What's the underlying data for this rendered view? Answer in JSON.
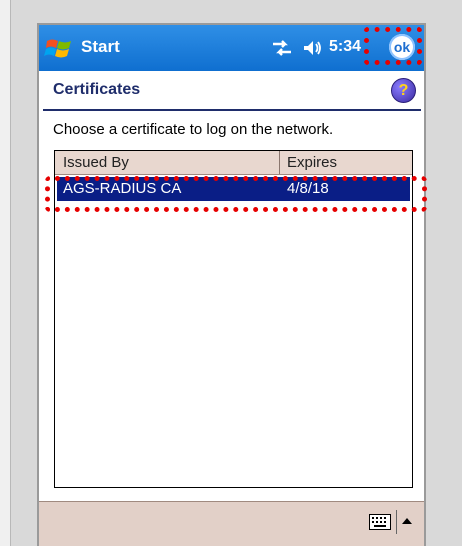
{
  "titlebar": {
    "title": "Start",
    "clock": "5:34",
    "ok_label": "ok"
  },
  "header": {
    "title": "Certificates",
    "help_symbol": "?"
  },
  "instruction": "Choose a certificate to log on the network.",
  "certificate_list": {
    "columns": [
      "Issued By",
      "Expires"
    ],
    "rows": [
      {
        "issued_by": "AGS-RADIUS CA",
        "expires": "4/8/18",
        "selected": true
      }
    ]
  },
  "icons": {
    "start_logo": "windows-flag-icon",
    "connectivity": "connectivity-icon",
    "volume": "speaker-icon",
    "help": "help-icon",
    "keyboard": "keyboard-icon",
    "input_menu": "up-arrow-icon"
  },
  "colors": {
    "titlebar": "#1f7fe0",
    "selection": "#0a1e86",
    "annotation": "#e60000",
    "header_text": "#1f2d6b"
  }
}
